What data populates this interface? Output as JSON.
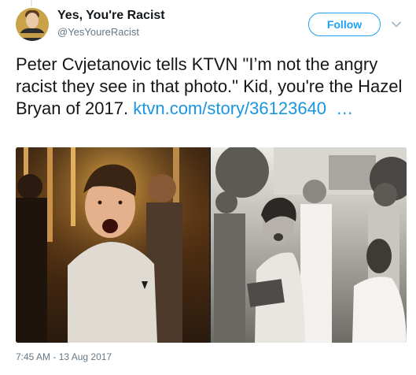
{
  "tweet": {
    "author_name": "Yes, You're Racist",
    "author_handle": "@YesYoureRacist",
    "follow_label": "Follow",
    "text": "Peter Cvjetanovic tells KTVN \"I’m not the angry racist they see in that photo.\" Kid, you're the Hazel Bryan of 2017.",
    "link_text": "ktvn.com/story/36123640  …",
    "timestamp": "7:45 AM - 13 Aug 2017"
  },
  "icons": {
    "menu": "chevron-down-icon"
  },
  "colors": {
    "accent": "#1da1f2",
    "link": "#1b95e0",
    "secondary_text": "#657786",
    "primary_text": "#14171a"
  }
}
